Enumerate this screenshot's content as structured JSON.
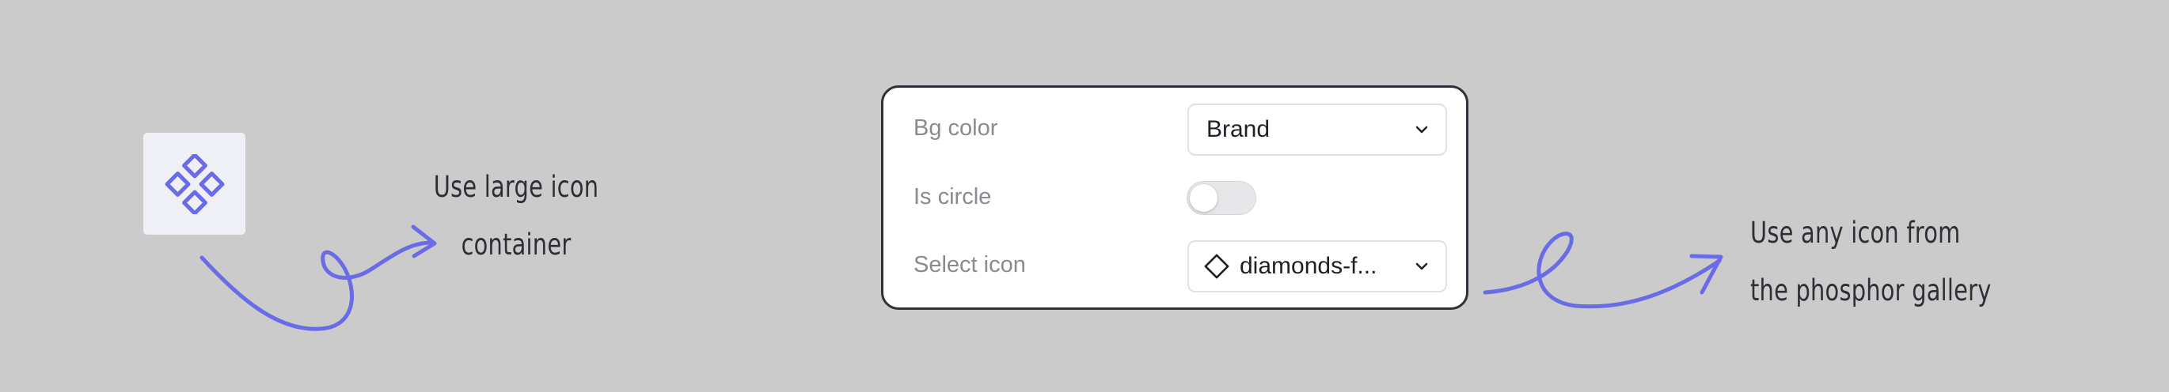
{
  "annotations": {
    "left_note": [
      "Use large icon",
      "container"
    ],
    "right_note": [
      "Use any icon from",
      "the phosphor gallery"
    ]
  },
  "icon_tile": {
    "icon": "diamonds-four-icon",
    "icon_color": "#6a6be6",
    "bg": "#efeff6"
  },
  "panel": {
    "bg_color": {
      "label": "Bg color",
      "value": "Brand"
    },
    "is_circle": {
      "label": "Is circle",
      "checked": false
    },
    "select_icon": {
      "label": "Select icon",
      "value": "diamonds-f...",
      "icon": "diamond-icon"
    }
  },
  "colors": {
    "arrow": "#6a6be6",
    "background": "#cbcbcb",
    "panel_border": "#2f3138"
  }
}
